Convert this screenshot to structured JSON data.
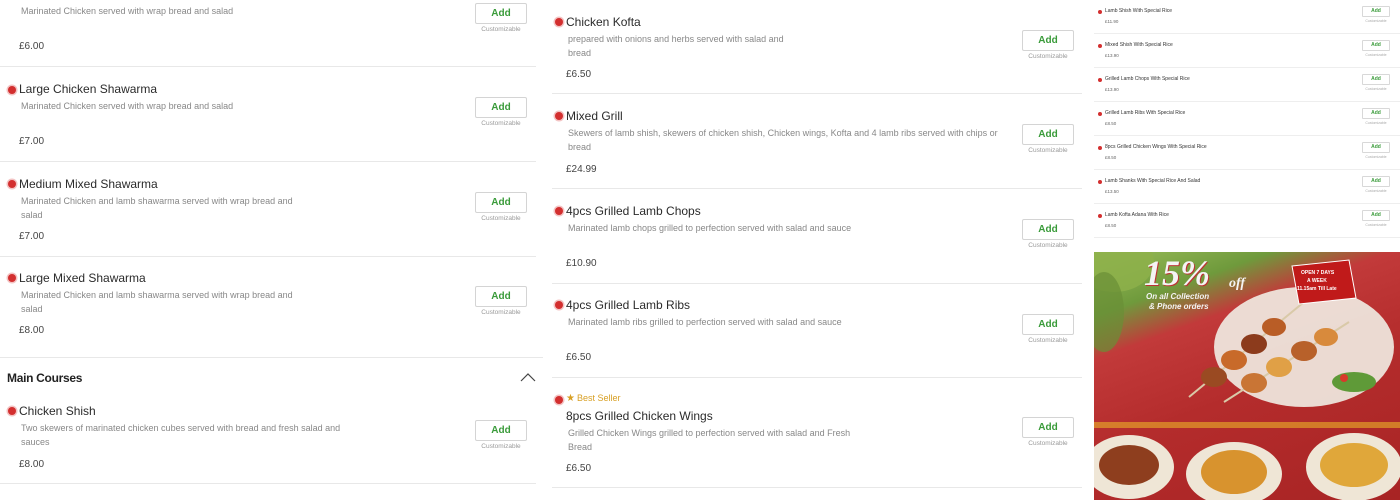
{
  "col1": {
    "items": [
      {
        "name": "",
        "desc": "Marinated Chicken served with wrap bread and salad",
        "price": "£6.00",
        "add": "Add",
        "cust": "Customizable"
      },
      {
        "name": "Large Chicken Shawarma",
        "desc": "Marinated Chicken served with wrap bread and salad",
        "price": "£7.00",
        "add": "Add",
        "cust": "Customizable"
      },
      {
        "name": "Medium Mixed Shawarma",
        "desc": "Marinated Chicken and lamb shawarma served with wrap bread and salad",
        "price": "£7.00",
        "add": "Add",
        "cust": "Customizable"
      },
      {
        "name": "Large Mixed Shawarma",
        "desc": "Marinated Chicken and lamb shawarma served with wrap bread and salad",
        "price": "£8.00",
        "add": "Add",
        "cust": "Customizable"
      }
    ],
    "section": {
      "title": "Main Courses"
    },
    "items2": [
      {
        "name": "Chicken Shish",
        "desc": "Two skewers of marinated chicken cubes served with bread and fresh salad and sauces",
        "price": "£8.00",
        "add": "Add",
        "cust": "Customizable"
      }
    ]
  },
  "col2": {
    "items": [
      {
        "name": "Chicken Kofta",
        "desc": "prepared with onions and herbs served with salad and bread",
        "price": "£6.50",
        "add": "Add",
        "cust": "Customizable"
      },
      {
        "name": "Mixed Grill",
        "desc": "Skewers of lamb shish, skewers of chicken shish, Chicken wings, Kofta and 4 lamb ribs served with chips or bread",
        "price": "£24.99",
        "add": "Add",
        "cust": "Customizable"
      },
      {
        "name": "4pcs Grilled Lamb Chops",
        "desc": "Marinated lamb chops grilled to perfection served with salad and sauce",
        "price": "£10.90",
        "add": "Add",
        "cust": "Customizable"
      },
      {
        "name": "4pcs Grilled Lamb Ribs",
        "desc": "Marinated lamb ribs grilled to perfection served with salad and sauce",
        "price": "£6.50",
        "add": "Add",
        "cust": "Customizable"
      },
      {
        "name": "8pcs Grilled Chicken Wings",
        "badge": "Best Seller",
        "desc": "Grilled Chicken Wings grilled to perfection served with salad and Fresh Bread",
        "price": "£6.50",
        "add": "Add",
        "cust": "Customizable"
      }
    ]
  },
  "col3": {
    "items": [
      {
        "name": "Lamb Shish With Special Rice",
        "price": "£11.90",
        "add": "Add",
        "cust": "Customizable"
      },
      {
        "name": "Mixed Shish With Special Rice",
        "price": "£13.90",
        "add": "Add",
        "cust": "Customizable"
      },
      {
        "name": "Grilled Lamb Chops With Special Rice",
        "price": "£13.90",
        "add": "Add",
        "cust": "Customizable"
      },
      {
        "name": "Grilled Lamb Ribs With Special Rice",
        "price": "£8.50",
        "add": "Add",
        "cust": "Customizable"
      },
      {
        "name": "8pcs Grilled Chicken Wings With Special Rice",
        "price": "£8.50",
        "add": "Add",
        "cust": "Customizable"
      },
      {
        "name": "Lamb Shanks With Special Rice And Salad",
        "price": "£13.50",
        "add": "Add",
        "cust": "Customizable"
      },
      {
        "name": "Lamb Kofta Adana With Rice",
        "price": "£8.50",
        "add": "Add",
        "cust": "Customizable"
      }
    ],
    "promo": {
      "headline": "15%",
      "off": "off",
      "sub1": "On all Collection",
      "sub2": "& Phone orders",
      "badge1": "OPEN 7 DAYS",
      "badge2": "A WEEK",
      "badge3": "11.15am Till Late"
    }
  },
  "colors": {
    "accent": "#3a9b3a",
    "dot": "#d32f2f",
    "badge": "#d8a025"
  },
  "icons": {
    "collapse": "chevron-up-icon",
    "bullet": "veg-nonveg-dot-icon",
    "star": "star-icon"
  }
}
